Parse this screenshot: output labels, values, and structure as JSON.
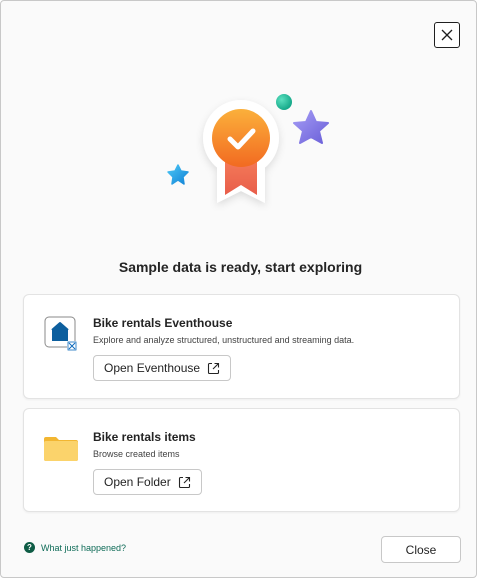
{
  "dialog": {
    "title": "Sample data is ready, start exploring",
    "close_icon": "close-icon"
  },
  "cards": [
    {
      "title": "Bike rentals Eventhouse",
      "description": "Explore and analyze structured, unstructured and streaming data.",
      "button_label": "Open Eventhouse",
      "icon": "eventhouse-icon",
      "button_icon": "open-external-icon"
    },
    {
      "title": "Bike rentals items",
      "description": "Browse created items",
      "button_label": "Open Folder",
      "icon": "folder-icon",
      "button_icon": "open-external-icon"
    }
  ],
  "footer": {
    "help_label": "What just happened?",
    "help_icon": "question-circle-icon",
    "close_label": "Close"
  },
  "colors": {
    "badge_orange": "#f7941d",
    "ribbon": "#ef6f4f",
    "star_purple": "#8b7fe8",
    "star_blue": "#1ea7e8",
    "dot_teal": "#27c2a3",
    "folder_yellow": "#f9cf5c",
    "link_green": "#0e6b57"
  }
}
